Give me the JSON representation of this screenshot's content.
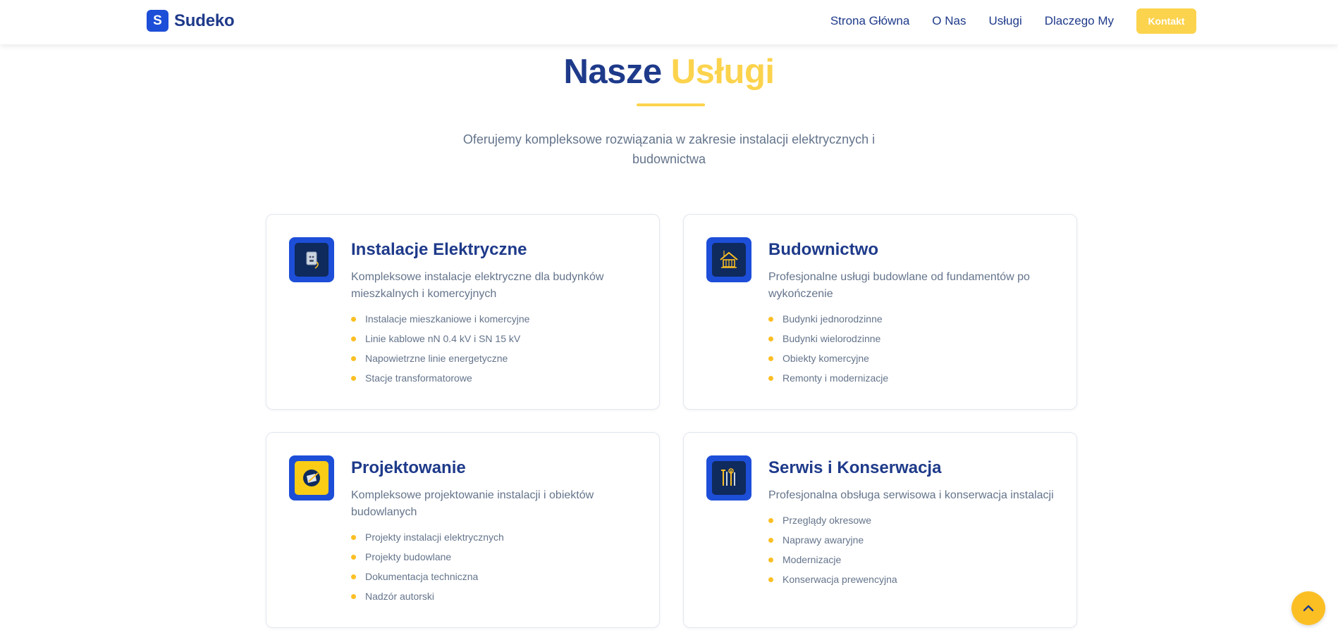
{
  "brand": {
    "logo_letter": "S",
    "name": "Sudeko"
  },
  "nav": {
    "items": [
      "Strona Główna",
      "O Nas",
      "Usługi",
      "Dlaczego My"
    ],
    "cta": "Kontakt"
  },
  "section": {
    "title_part1": "Nasze",
    "title_part2": "Usługi",
    "subtitle": "Oferujemy kompleksowe rozwiązania w zakresie instalacji elektrycznych i budownictwa"
  },
  "services": [
    {
      "icon": "electrical-socket-icon",
      "title": "Instalacje Elektryczne",
      "description": "Kompleksowe instalacje elektryczne dla budynków mieszkalnych i komercyjnych",
      "items": [
        "Instalacje mieszkaniowe i komercyjne",
        "Linie kablowe nN 0.4 kV i SN 15 kV",
        "Napowietrzne linie energetyczne",
        "Stacje transformatorowe"
      ]
    },
    {
      "icon": "house-construction-icon",
      "title": "Budownictwo",
      "description": "Profesjonalne usługi budowlane od fundamentów po wykończenie",
      "items": [
        "Budynki jednorodzinne",
        "Budynki wielorodzinne",
        "Obiekty komercyjne",
        "Remonty i modernizacje"
      ]
    },
    {
      "icon": "blueprint-design-icon",
      "title": "Projektowanie",
      "description": "Kompleksowe projektowanie instalacji i obiektów budowlanych",
      "items": [
        "Projekty instalacji elektrycznych",
        "Projekty budowlane",
        "Dokumentacja techniczna",
        "Nadzór autorski"
      ]
    },
    {
      "icon": "tools-service-icon",
      "title": "Serwis i Konserwacja",
      "description": "Profesjonalna obsługa serwisowa i konserwacja instalacji",
      "items": [
        "Przeglądy okresowe",
        "Naprawy awaryjne",
        "Modernizacje",
        "Konserwacja prewencyjna"
      ]
    }
  ],
  "colors": {
    "navy": "#1e3a8a",
    "blue": "#1d4ed8",
    "yellow": "#fcd34d",
    "gray": "#64748b"
  },
  "scroll_top_icon": "chevron-up-icon"
}
